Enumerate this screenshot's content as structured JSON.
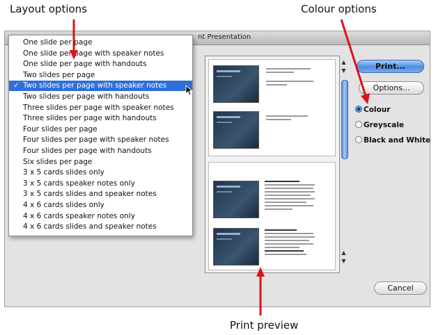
{
  "annotations": {
    "layout": "Layout options",
    "colour": "Colour options",
    "preview": "Print preview"
  },
  "dialog": {
    "title_fragment": "nt Presentation"
  },
  "layout_menu": {
    "check_mark": "✓",
    "items": [
      "One slide per page",
      "One slide per page with speaker notes",
      "One slide per page with handouts",
      "Two slides per page",
      "Two slides per page with speaker notes",
      "Two slides per page with handouts",
      "Three slides per page with speaker notes",
      "Three slides per page with handouts",
      "Four slides per page",
      "Four slides per page with speaker notes",
      "Four slides per page with handouts",
      "Six slides per page",
      "3 x 5 cards slides only",
      "3 x 5 cards speaker notes only",
      "3 x 5 cards slides and speaker notes",
      "4 x 6 cards slides only",
      "4 x 6 cards speaker notes only",
      "4 x 6 cards slides and speaker notes"
    ],
    "selected_index": 4
  },
  "buttons": {
    "print": "Print...",
    "options": "Options...",
    "cancel": "Cancel"
  },
  "colour_options": {
    "items": [
      "Colour",
      "Greyscale",
      "Black and White"
    ],
    "selected_index": 0
  },
  "colors": {
    "accent": "#2f6fd7",
    "arrow": "#d9141b"
  }
}
